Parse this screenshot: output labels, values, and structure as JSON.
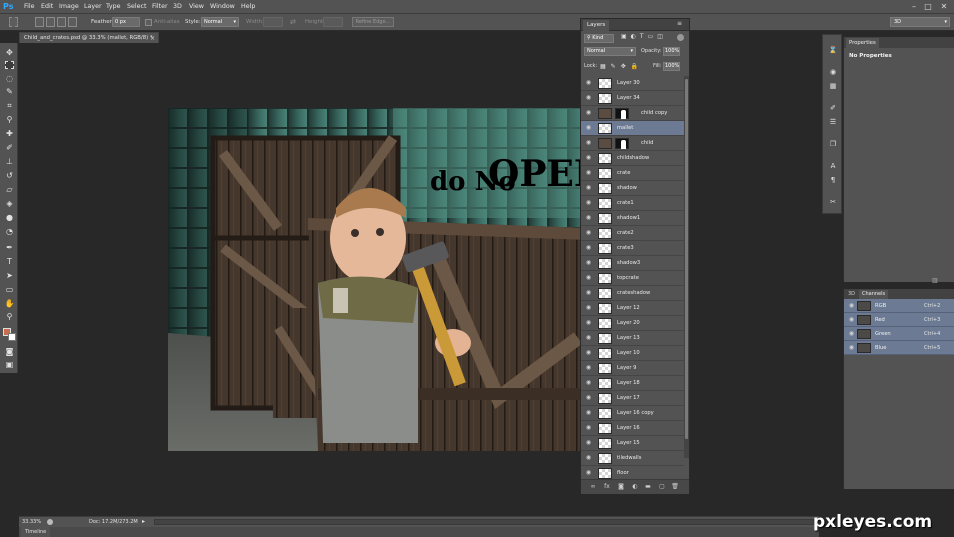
{
  "app": {
    "logo": "Ps",
    "accent": "#31a8ff"
  },
  "menu": [
    "File",
    "Edit",
    "Image",
    "Layer",
    "Type",
    "Select",
    "Filter",
    "3D",
    "View",
    "Window",
    "Help"
  ],
  "window_controls": {
    "minimize": "–",
    "restore": "□",
    "close": "✕"
  },
  "options": {
    "feather_label": "Feather:",
    "feather_value": "0 px",
    "antialias_label": "Anti-alias",
    "style_label": "Style:",
    "style_value": "Normal",
    "width_label": "Width:",
    "height_label": "Height:",
    "refine_edge_label": "Refine Edge...",
    "workspace_value": "3D"
  },
  "document": {
    "tab_title": "Child_and_crates.psd @ 33.3% (mallet, RGB/8) *",
    "close": "×",
    "sign_line1": "do No",
    "sign_line2": "OPEN"
  },
  "status": {
    "zoom": "33.33%",
    "doc_info": "Doc: 17.2M/273.2M",
    "timeline_label": "Timeline"
  },
  "layers_panel": {
    "tab": "Layers",
    "kind_filter": "Kind",
    "blend_mode": "Normal",
    "opacity_label": "Opacity:",
    "opacity_value": "100%",
    "lock_label": "Lock:",
    "fill_label": "Fill:",
    "fill_value": "100%",
    "layers": [
      {
        "name": "Layer 30",
        "mask": false,
        "selected": false
      },
      {
        "name": "Layer 34",
        "mask": false,
        "selected": false
      },
      {
        "name": "child copy",
        "mask": true,
        "selected": false
      },
      {
        "name": "mallet",
        "mask": false,
        "selected": true
      },
      {
        "name": "child",
        "mask": true,
        "selected": false
      },
      {
        "name": "childshadow",
        "mask": false,
        "selected": false
      },
      {
        "name": "crate",
        "mask": false,
        "selected": false
      },
      {
        "name": "shadow",
        "mask": false,
        "selected": false
      },
      {
        "name": "crate1",
        "mask": false,
        "selected": false
      },
      {
        "name": "shadow1",
        "mask": false,
        "selected": false
      },
      {
        "name": "crate2",
        "mask": false,
        "selected": false
      },
      {
        "name": "crate3",
        "mask": false,
        "selected": false
      },
      {
        "name": "shadow3",
        "mask": false,
        "selected": false
      },
      {
        "name": "topcrate",
        "mask": false,
        "selected": false
      },
      {
        "name": "crateshadow",
        "mask": false,
        "selected": false
      },
      {
        "name": "Layer 12",
        "mask": false,
        "selected": false
      },
      {
        "name": "Layer 20",
        "mask": false,
        "selected": false
      },
      {
        "name": "Layer 13",
        "mask": false,
        "selected": false
      },
      {
        "name": "Layer 10",
        "mask": false,
        "selected": false
      },
      {
        "name": "Layer 9",
        "mask": false,
        "selected": false
      },
      {
        "name": "Layer 18",
        "mask": false,
        "selected": false
      },
      {
        "name": "Layer 17",
        "mask": false,
        "selected": false
      },
      {
        "name": "Layer 16 copy",
        "mask": false,
        "selected": false
      },
      {
        "name": "Layer 16",
        "mask": false,
        "selected": false
      },
      {
        "name": "Layer 15",
        "mask": false,
        "selected": false
      },
      {
        "name": "tiledwalls",
        "mask": false,
        "selected": false
      },
      {
        "name": "floor",
        "mask": false,
        "selected": false
      }
    ]
  },
  "properties_panel": {
    "tab": "Properties",
    "note": "No Properties"
  },
  "channels_panel": {
    "tab_3d": "3D",
    "tab": "Channels",
    "channels": [
      {
        "name": "RGB",
        "shortcut": "Ctrl+2"
      },
      {
        "name": "Red",
        "shortcut": "Ctrl+3"
      },
      {
        "name": "Green",
        "shortcut": "Ctrl+4"
      },
      {
        "name": "Blue",
        "shortcut": "Ctrl+5"
      }
    ]
  },
  "watermark": "pxleyes.com"
}
